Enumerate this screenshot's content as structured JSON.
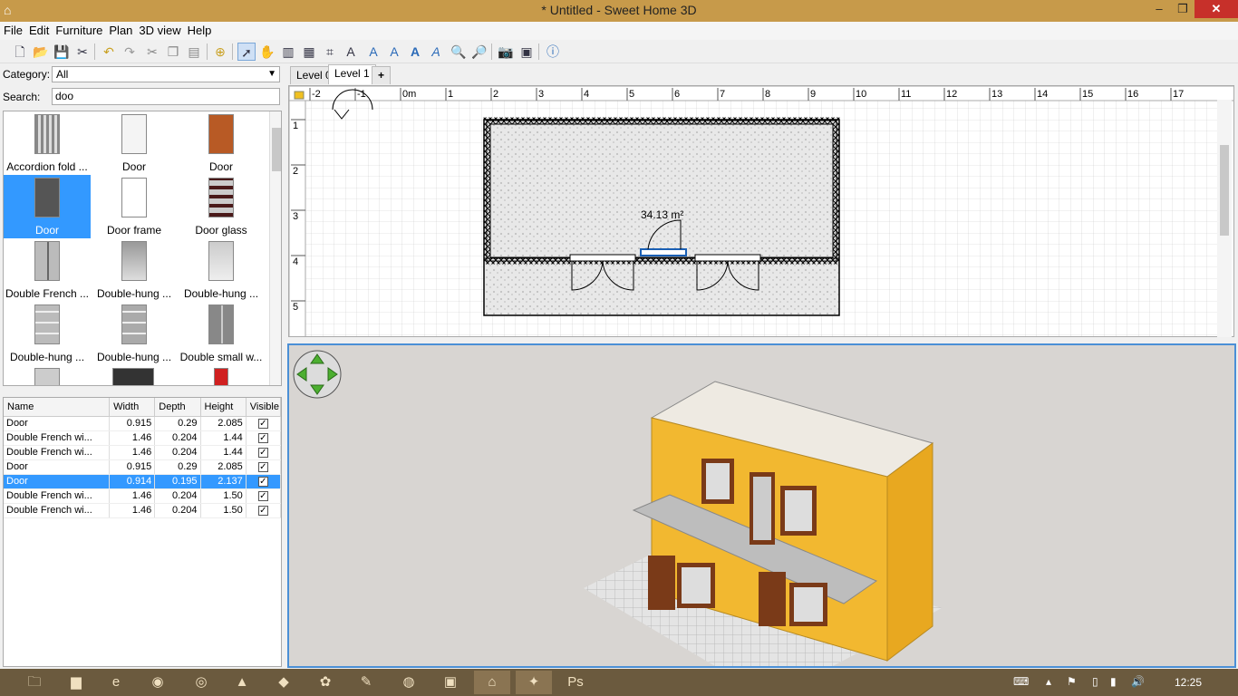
{
  "window": {
    "title": "* Untitled - Sweet Home 3D",
    "minimize": "–",
    "maximize": "❐",
    "close": "✕"
  },
  "menu": [
    "File",
    "Edit",
    "Furniture",
    "Plan",
    "3D view",
    "Help"
  ],
  "toolbar": {
    "icons": [
      "new-file-icon",
      "open-icon",
      "save-icon",
      "cut-scissors-icon",
      "undo-icon",
      "redo-icon",
      "cut-icon",
      "copy-icon",
      "paste-icon",
      "add-furniture-icon",
      "select-arrow-icon",
      "pan-hand-icon",
      "create-walls-icon",
      "create-rooms-icon",
      "create-polylines-icon",
      "add-text-icon",
      "increase-text-icon",
      "decrease-text-icon",
      "bold-text-icon",
      "italic-text-icon",
      "zoom-in-icon",
      "zoom-out-icon",
      "create-photo-icon",
      "create-video-icon",
      "help-icon"
    ]
  },
  "catalog": {
    "category_label": "Category:",
    "category_value": "All",
    "search_label": "Search:",
    "search_value": "doo",
    "items": [
      {
        "label": "Accordion fold ..."
      },
      {
        "label": "Door"
      },
      {
        "label": "Door"
      },
      {
        "label": "Door",
        "selected": true
      },
      {
        "label": "Door frame"
      },
      {
        "label": "Door glass"
      },
      {
        "label": "Double French ..."
      },
      {
        "label": "Double-hung ..."
      },
      {
        "label": "Double-hung ..."
      },
      {
        "label": "Double-hung ..."
      },
      {
        "label": "Double-hung ..."
      },
      {
        "label": "Double small w..."
      },
      {
        "label": ""
      },
      {
        "label": ""
      },
      {
        "label": ""
      }
    ]
  },
  "furniture_table": {
    "headers": [
      "Name",
      "Width",
      "Depth",
      "Height",
      "Visible"
    ],
    "rows": [
      {
        "name": "Door",
        "width": "0.915",
        "depth": "0.29",
        "height": "2.085",
        "visible": true
      },
      {
        "name": "Double French wi...",
        "width": "1.46",
        "depth": "0.204",
        "height": "1.44",
        "visible": true
      },
      {
        "name": "Double French wi...",
        "width": "1.46",
        "depth": "0.204",
        "height": "1.44",
        "visible": true
      },
      {
        "name": "Door",
        "width": "0.915",
        "depth": "0.29",
        "height": "2.085",
        "visible": true
      },
      {
        "name": "Door",
        "width": "0.914",
        "depth": "0.195",
        "height": "2.137",
        "visible": true,
        "selected": true
      },
      {
        "name": "Double French wi...",
        "width": "1.46",
        "depth": "0.204",
        "height": "1.50",
        "visible": true
      },
      {
        "name": "Double French wi...",
        "width": "1.46",
        "depth": "0.204",
        "height": "1.50",
        "visible": true
      }
    ]
  },
  "plan": {
    "tabs": [
      "Level 0",
      "Level 1"
    ],
    "active_tab": "Level 1",
    "add_tab": "+",
    "ruler_x": [
      "-2",
      "-1",
      "0m",
      "1",
      "2",
      "3",
      "4",
      "5",
      "6",
      "7",
      "8",
      "9",
      "10",
      "11",
      "12",
      "13",
      "14",
      "15",
      "16",
      "17"
    ],
    "ruler_y": [
      "1",
      "2",
      "3",
      "4",
      "5"
    ],
    "room_area": "34.13 m²"
  },
  "taskbar": {
    "icons": [
      "file-explorer-icon",
      "library-icon",
      "internet-explorer-icon",
      "media-player-icon",
      "chrome-icon",
      "inkscape-icon",
      "app-icon",
      "game-icon",
      "paint-icon",
      "browser-icon",
      "photos-icon",
      "sweethome3d-icon",
      "acrobat-icon",
      "photoshop-icon"
    ],
    "clock": "12:25",
    "tray": [
      "keyboard-icon",
      "chevron-up-icon",
      "flag-icon",
      "battery-icon",
      "signal-icon",
      "volume-icon"
    ]
  },
  "colors": {
    "accent": "#3399ff",
    "title_bar": "#c79a4a",
    "house_wall": "#f0b830",
    "taskbar": "#6b5a3e"
  }
}
